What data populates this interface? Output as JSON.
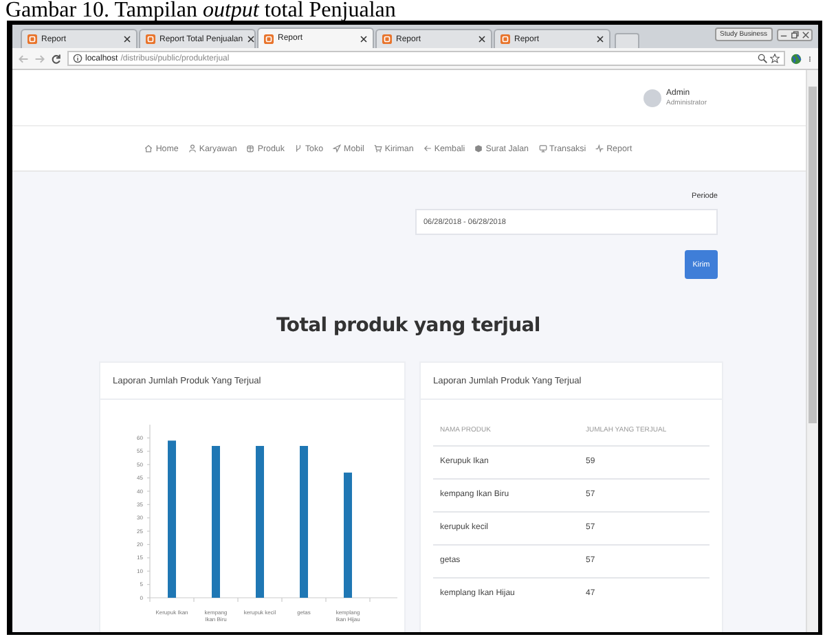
{
  "caption": "Gambar 10. Tampilan *output* total Penjualan",
  "browser": {
    "tabs": [
      {
        "label": "Report",
        "selected": false
      },
      {
        "label": "Report Total Penjualan",
        "selected": false
      },
      {
        "label": "Report",
        "selected": true
      },
      {
        "label": "Report",
        "selected": false
      },
      {
        "label": "Report",
        "selected": false
      }
    ],
    "profile": "Study Business",
    "address": {
      "host": "localhost",
      "path": "/distribusi/public/produkterjual"
    }
  },
  "header": {
    "user_name": "Admin",
    "user_role": "Administrator"
  },
  "nav": [
    {
      "label": "Home"
    },
    {
      "label": "Karyawan"
    },
    {
      "label": "Produk"
    },
    {
      "label": "Toko"
    },
    {
      "label": "Mobil"
    },
    {
      "label": "Kiriman"
    },
    {
      "label": "Kembali"
    },
    {
      "label": "Surat Jalan"
    },
    {
      "label": "Transaksi"
    },
    {
      "label": "Report"
    }
  ],
  "filter": {
    "label": "Periode",
    "value": "06/28/2018 - 06/28/2018",
    "button": "Kirim"
  },
  "title": "Total produk yang terjual",
  "chart_card": {
    "title": "Laporan Jumlah Produk Yang Terjual",
    "chart_data": {
      "type": "bar",
      "categories": [
        "Kerupuk Ikan",
        "kempang Ikan Biru",
        "kerupuk kecil",
        "getas",
        "kemplang Ikan Hijau"
      ],
      "values": [
        59,
        57,
        57,
        57,
        47
      ],
      "ylim": [
        0,
        65
      ],
      "yticks": [
        0,
        5,
        10,
        15,
        20,
        25,
        30,
        35,
        40,
        45,
        50,
        55,
        60
      ]
    }
  },
  "table_card": {
    "title": "Laporan Jumlah Produk Yang Terjual",
    "columns": [
      "NAMA PRODUK",
      "JUMLAH YANG TERJUAL"
    ],
    "rows": [
      [
        "Kerupuk Ikan",
        "59"
      ],
      [
        "kempang Ikan Biru",
        "57"
      ],
      [
        "kerupuk kecil",
        "57"
      ],
      [
        "getas",
        "57"
      ],
      [
        "kemplang Ikan Hijau",
        "47"
      ]
    ]
  }
}
